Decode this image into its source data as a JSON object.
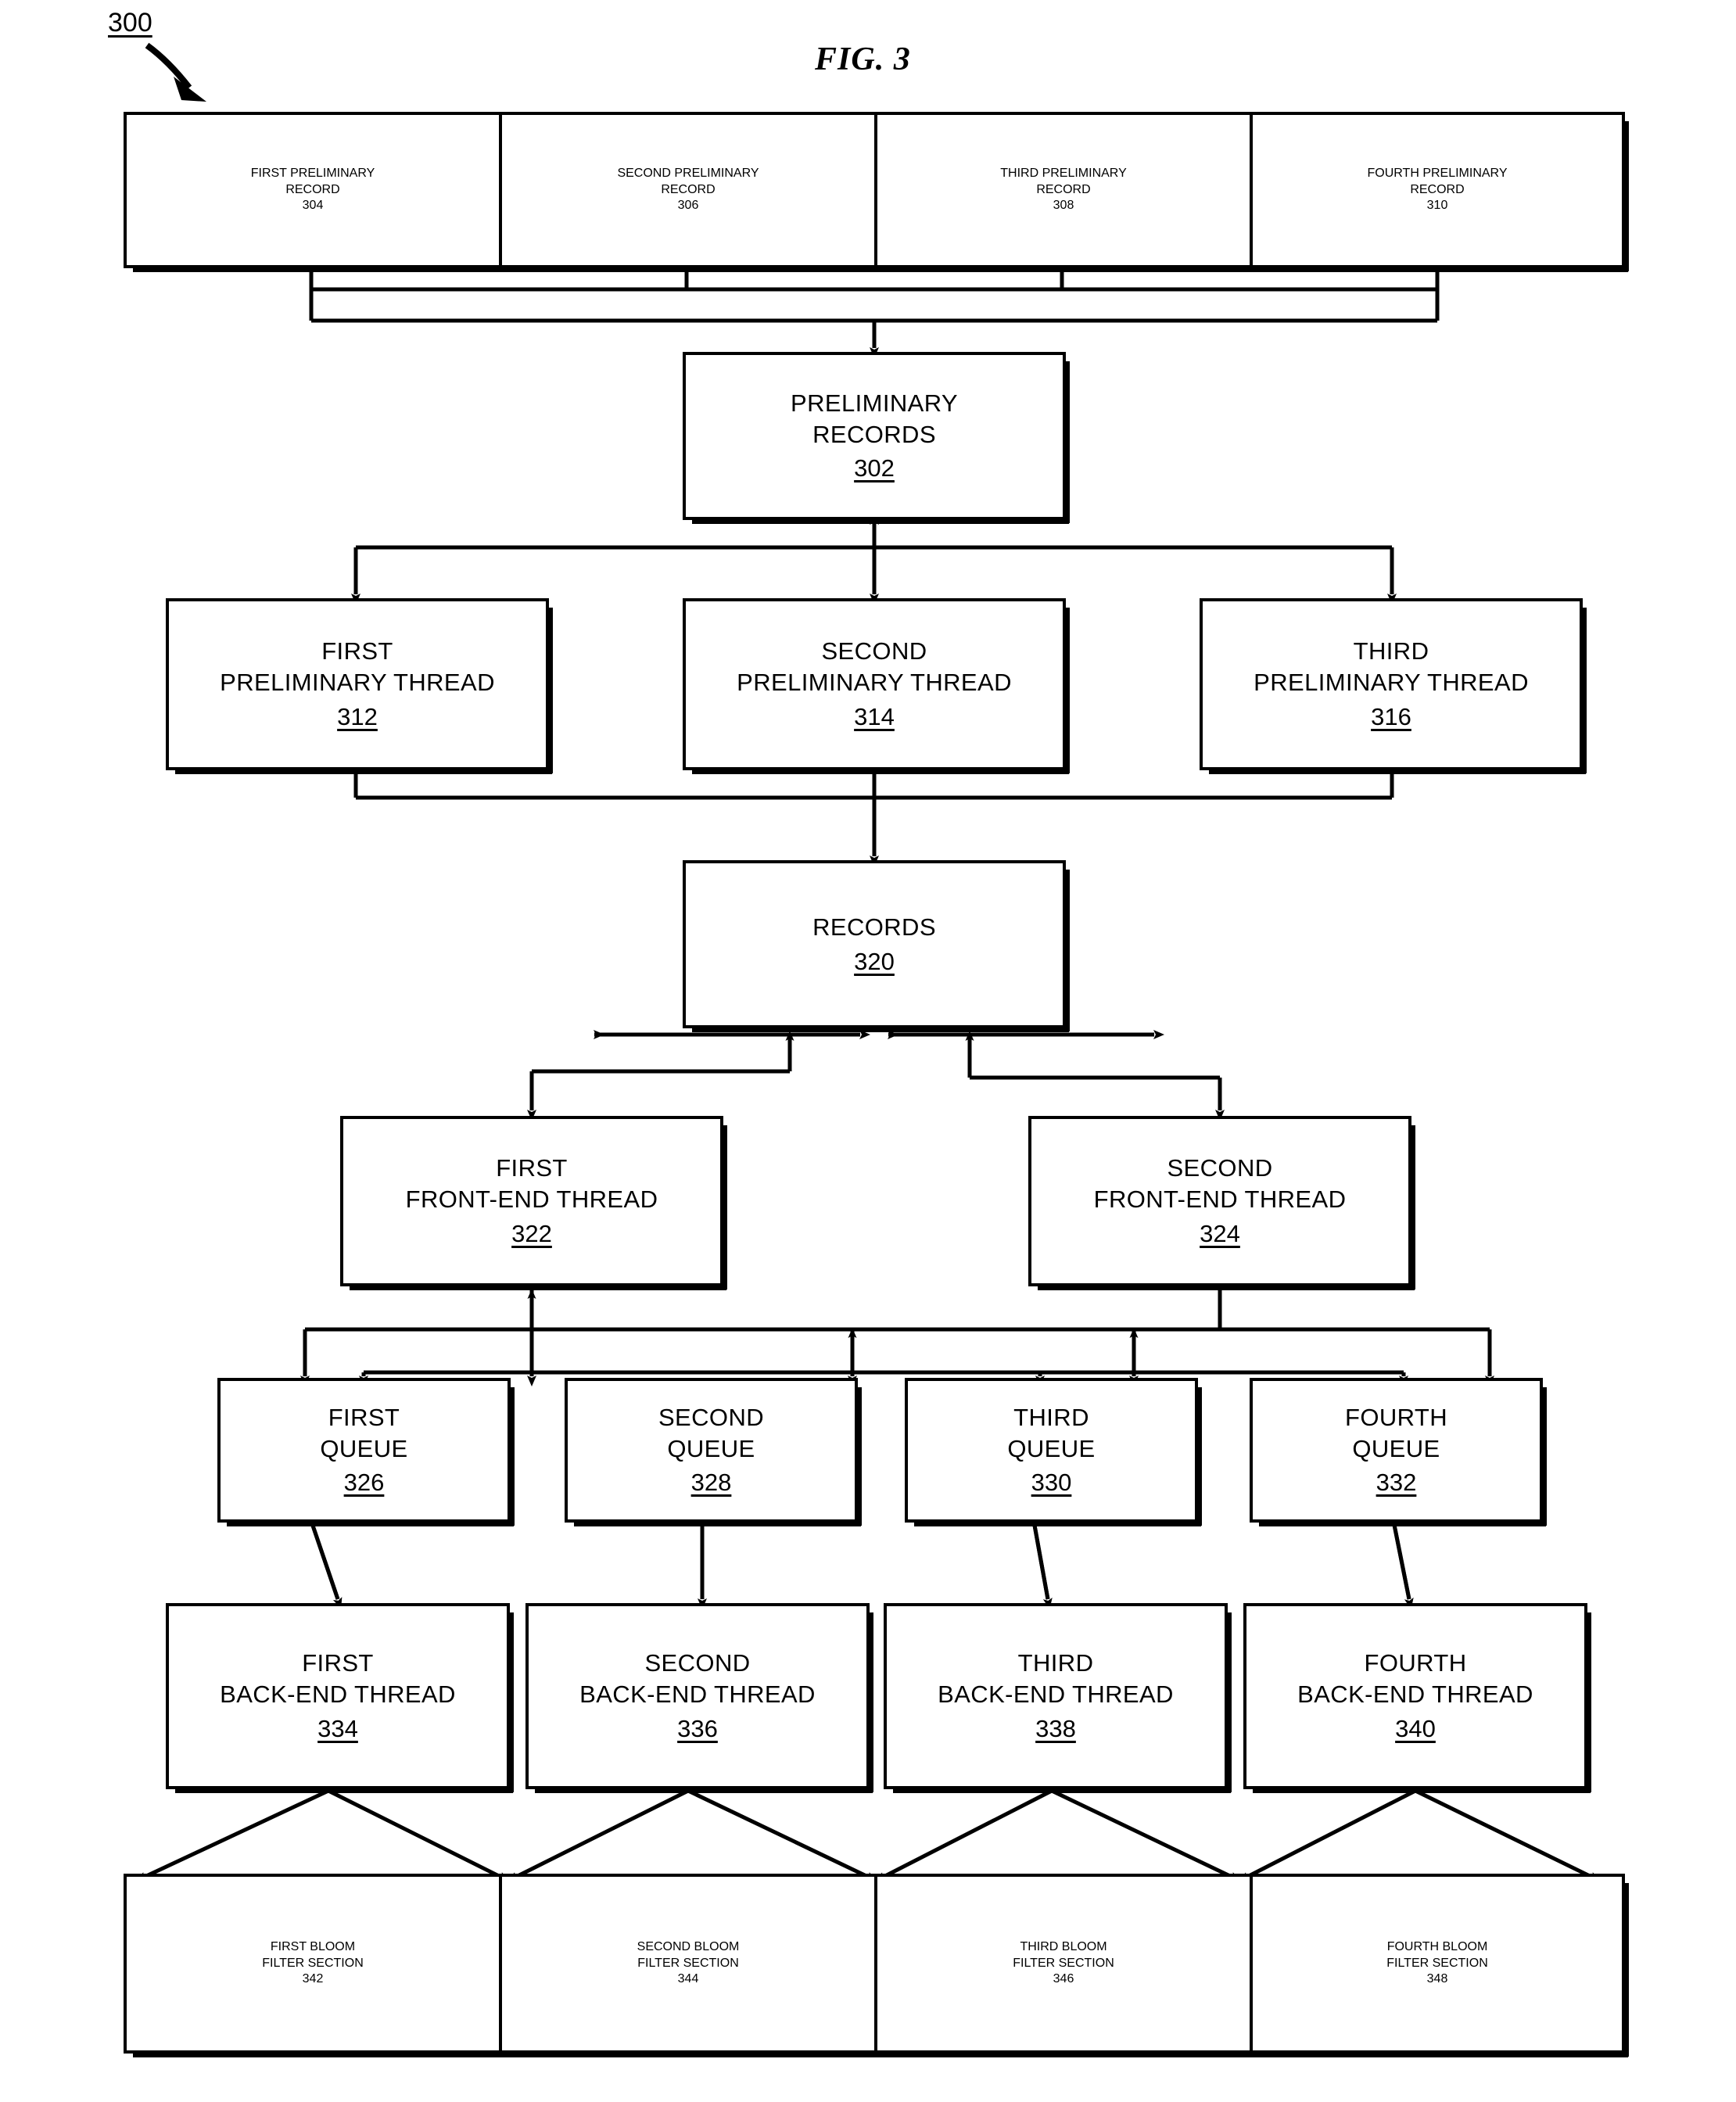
{
  "figure": {
    "title": "FIG. 3",
    "diagram_ref": "300"
  },
  "preliminary_records_row": {
    "items": [
      {
        "line1": "FIRST PRELIMINARY",
        "line2": "RECORD",
        "num": "304"
      },
      {
        "line1": "SECOND PRELIMINARY",
        "line2": "RECORD",
        "num": "306"
      },
      {
        "line1": "THIRD PRELIMINARY",
        "line2": "RECORD",
        "num": "308"
      },
      {
        "line1": "FOURTH PRELIMINARY",
        "line2": "RECORD",
        "num": "310"
      }
    ]
  },
  "preliminary_records": {
    "line1": "PRELIMINARY",
    "line2": "RECORDS",
    "num": "302"
  },
  "preliminary_threads": [
    {
      "line1": "FIRST",
      "line2": "PRELIMINARY THREAD",
      "num": "312"
    },
    {
      "line1": "SECOND",
      "line2": "PRELIMINARY THREAD",
      "num": "314"
    },
    {
      "line1": "THIRD",
      "line2": "PRELIMINARY THREAD",
      "num": "316"
    }
  ],
  "records": {
    "line1": "RECORDS",
    "num": "320"
  },
  "front_end_threads": [
    {
      "line1": "FIRST",
      "line2": "FRONT-END THREAD",
      "num": "322"
    },
    {
      "line1": "SECOND",
      "line2": "FRONT-END THREAD",
      "num": "324"
    }
  ],
  "queues": [
    {
      "line1": "FIRST",
      "line2": "QUEUE",
      "num": "326"
    },
    {
      "line1": "SECOND",
      "line2": "QUEUE",
      "num": "328"
    },
    {
      "line1": "THIRD",
      "line2": "QUEUE",
      "num": "330"
    },
    {
      "line1": "FOURTH",
      "line2": "QUEUE",
      "num": "332"
    }
  ],
  "back_end_threads": [
    {
      "line1": "FIRST",
      "line2": "BACK-END THREAD",
      "num": "334"
    },
    {
      "line1": "SECOND",
      "line2": "BACK-END THREAD",
      "num": "336"
    },
    {
      "line1": "THIRD",
      "line2": "BACK-END THREAD",
      "num": "338"
    },
    {
      "line1": "FOURTH",
      "line2": "BACK-END THREAD",
      "num": "340"
    }
  ],
  "bloom_filter_sections": [
    {
      "line1": "FIRST BLOOM",
      "line2": "FILTER SECTION",
      "num": "342"
    },
    {
      "line1": "SECOND BLOOM",
      "line2": "FILTER SECTION",
      "num": "344"
    },
    {
      "line1": "THIRD BLOOM",
      "line2": "FILTER SECTION",
      "num": "346"
    },
    {
      "line1": "FOURTH BLOOM",
      "line2": "FILTER SECTION",
      "num": "348"
    }
  ],
  "colors": {
    "stroke": "#000000",
    "background": "#ffffff"
  }
}
